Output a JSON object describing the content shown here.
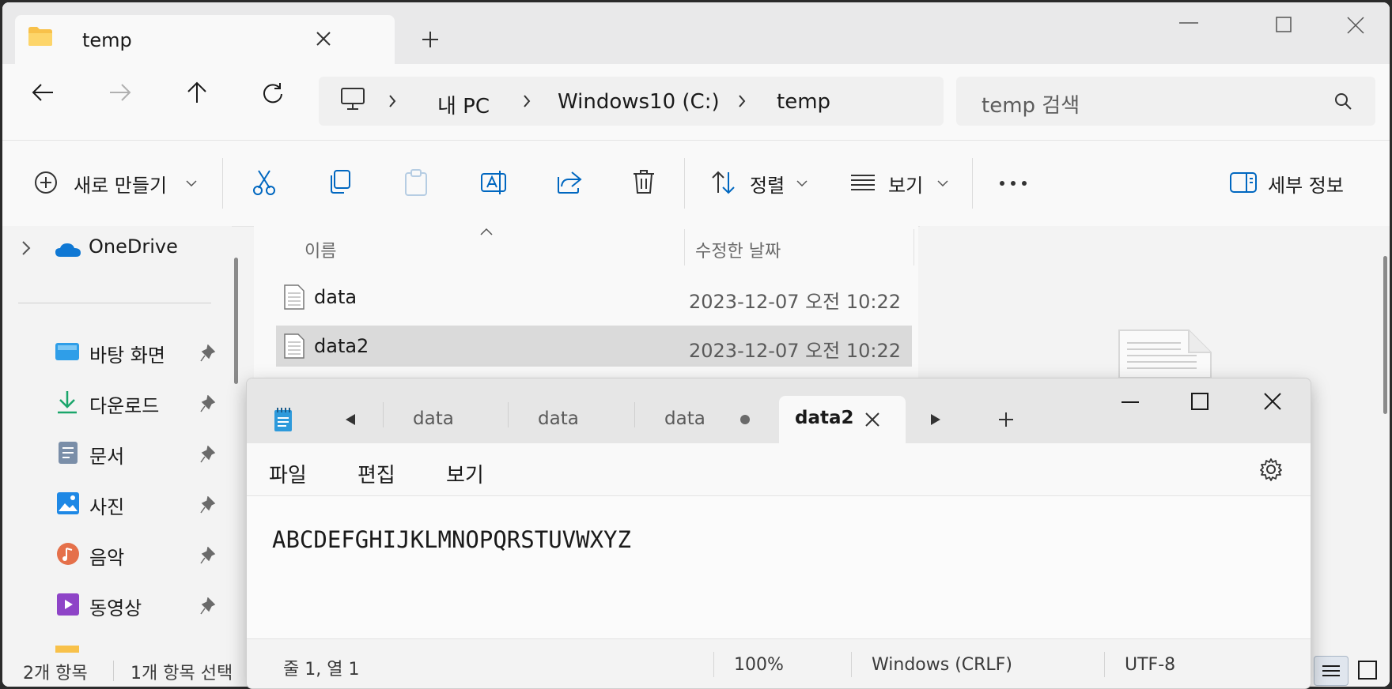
{
  "explorer": {
    "tab_title": "temp",
    "breadcrumbs": [
      "내 PC",
      "Windows10 (C:)",
      "temp"
    ],
    "search_placeholder": "temp 검색",
    "toolbar": {
      "new_label": "새로 만들기",
      "sort_label": "정렬",
      "view_label": "보기",
      "details_label": "세부 정보"
    },
    "nav": {
      "onedrive": "OneDrive",
      "items": [
        {
          "label": "바탕 화면",
          "icon": "desktop-icon"
        },
        {
          "label": "다운로드",
          "icon": "download-icon"
        },
        {
          "label": "문서",
          "icon": "documents-icon"
        },
        {
          "label": "사진",
          "icon": "pictures-icon"
        },
        {
          "label": "음악",
          "icon": "music-icon"
        },
        {
          "label": "동영상",
          "icon": "videos-icon"
        }
      ]
    },
    "columns": {
      "name": "이름",
      "modified": "수정한 날짜"
    },
    "files": [
      {
        "name": "data",
        "modified": "2023-12-07 오전 10:22",
        "selected": false
      },
      {
        "name": "data2",
        "modified": "2023-12-07 오전 10:22",
        "selected": true
      }
    ],
    "status": {
      "count": "2개 항목",
      "selected": "1개 항목 선택"
    }
  },
  "notepad": {
    "tabs": [
      {
        "label": "data"
      },
      {
        "label": "data"
      },
      {
        "label": "data",
        "unsaved": true
      },
      {
        "label": "data2",
        "active": true
      }
    ],
    "menu": {
      "file": "파일",
      "edit": "편집",
      "view": "보기"
    },
    "content": "ABCDEFGHIJKLMNOPQRSTUVWXYZ",
    "status": {
      "position": "줄 1, 열 1",
      "zoom": "100%",
      "line_ending": "Windows (CRLF)",
      "encoding": "UTF-8"
    }
  },
  "colors": {
    "accent": "#0067c0",
    "selected_row": "#dadada"
  }
}
